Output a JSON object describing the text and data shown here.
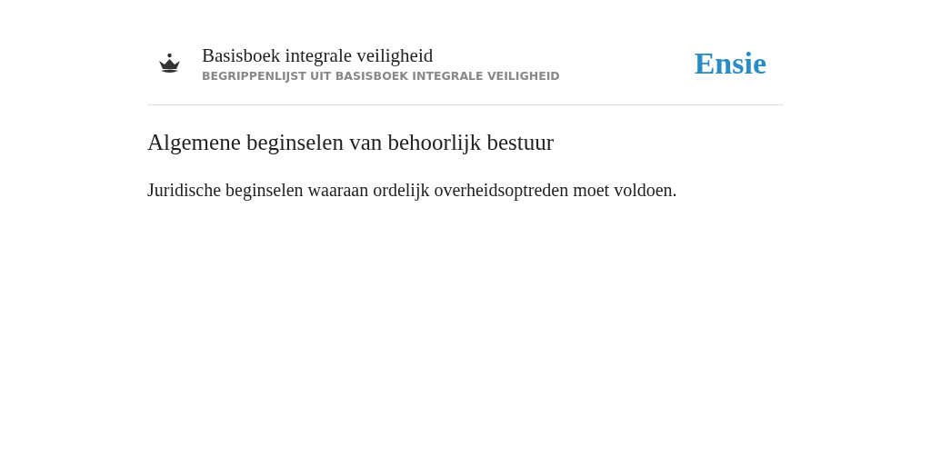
{
  "header": {
    "title": "Basisboek integrale veiligheid",
    "subtitle": "BEGRIPPENLIJST UIT BASISBOEK INTEGRALE VEILIGHEID",
    "logo": "Ensie"
  },
  "term": {
    "heading": "Algemene beginselen van behoorlijk bestuur",
    "definition": "Juridische beginselen waaraan ordelijk overheidsoptreden moet voldoen."
  }
}
